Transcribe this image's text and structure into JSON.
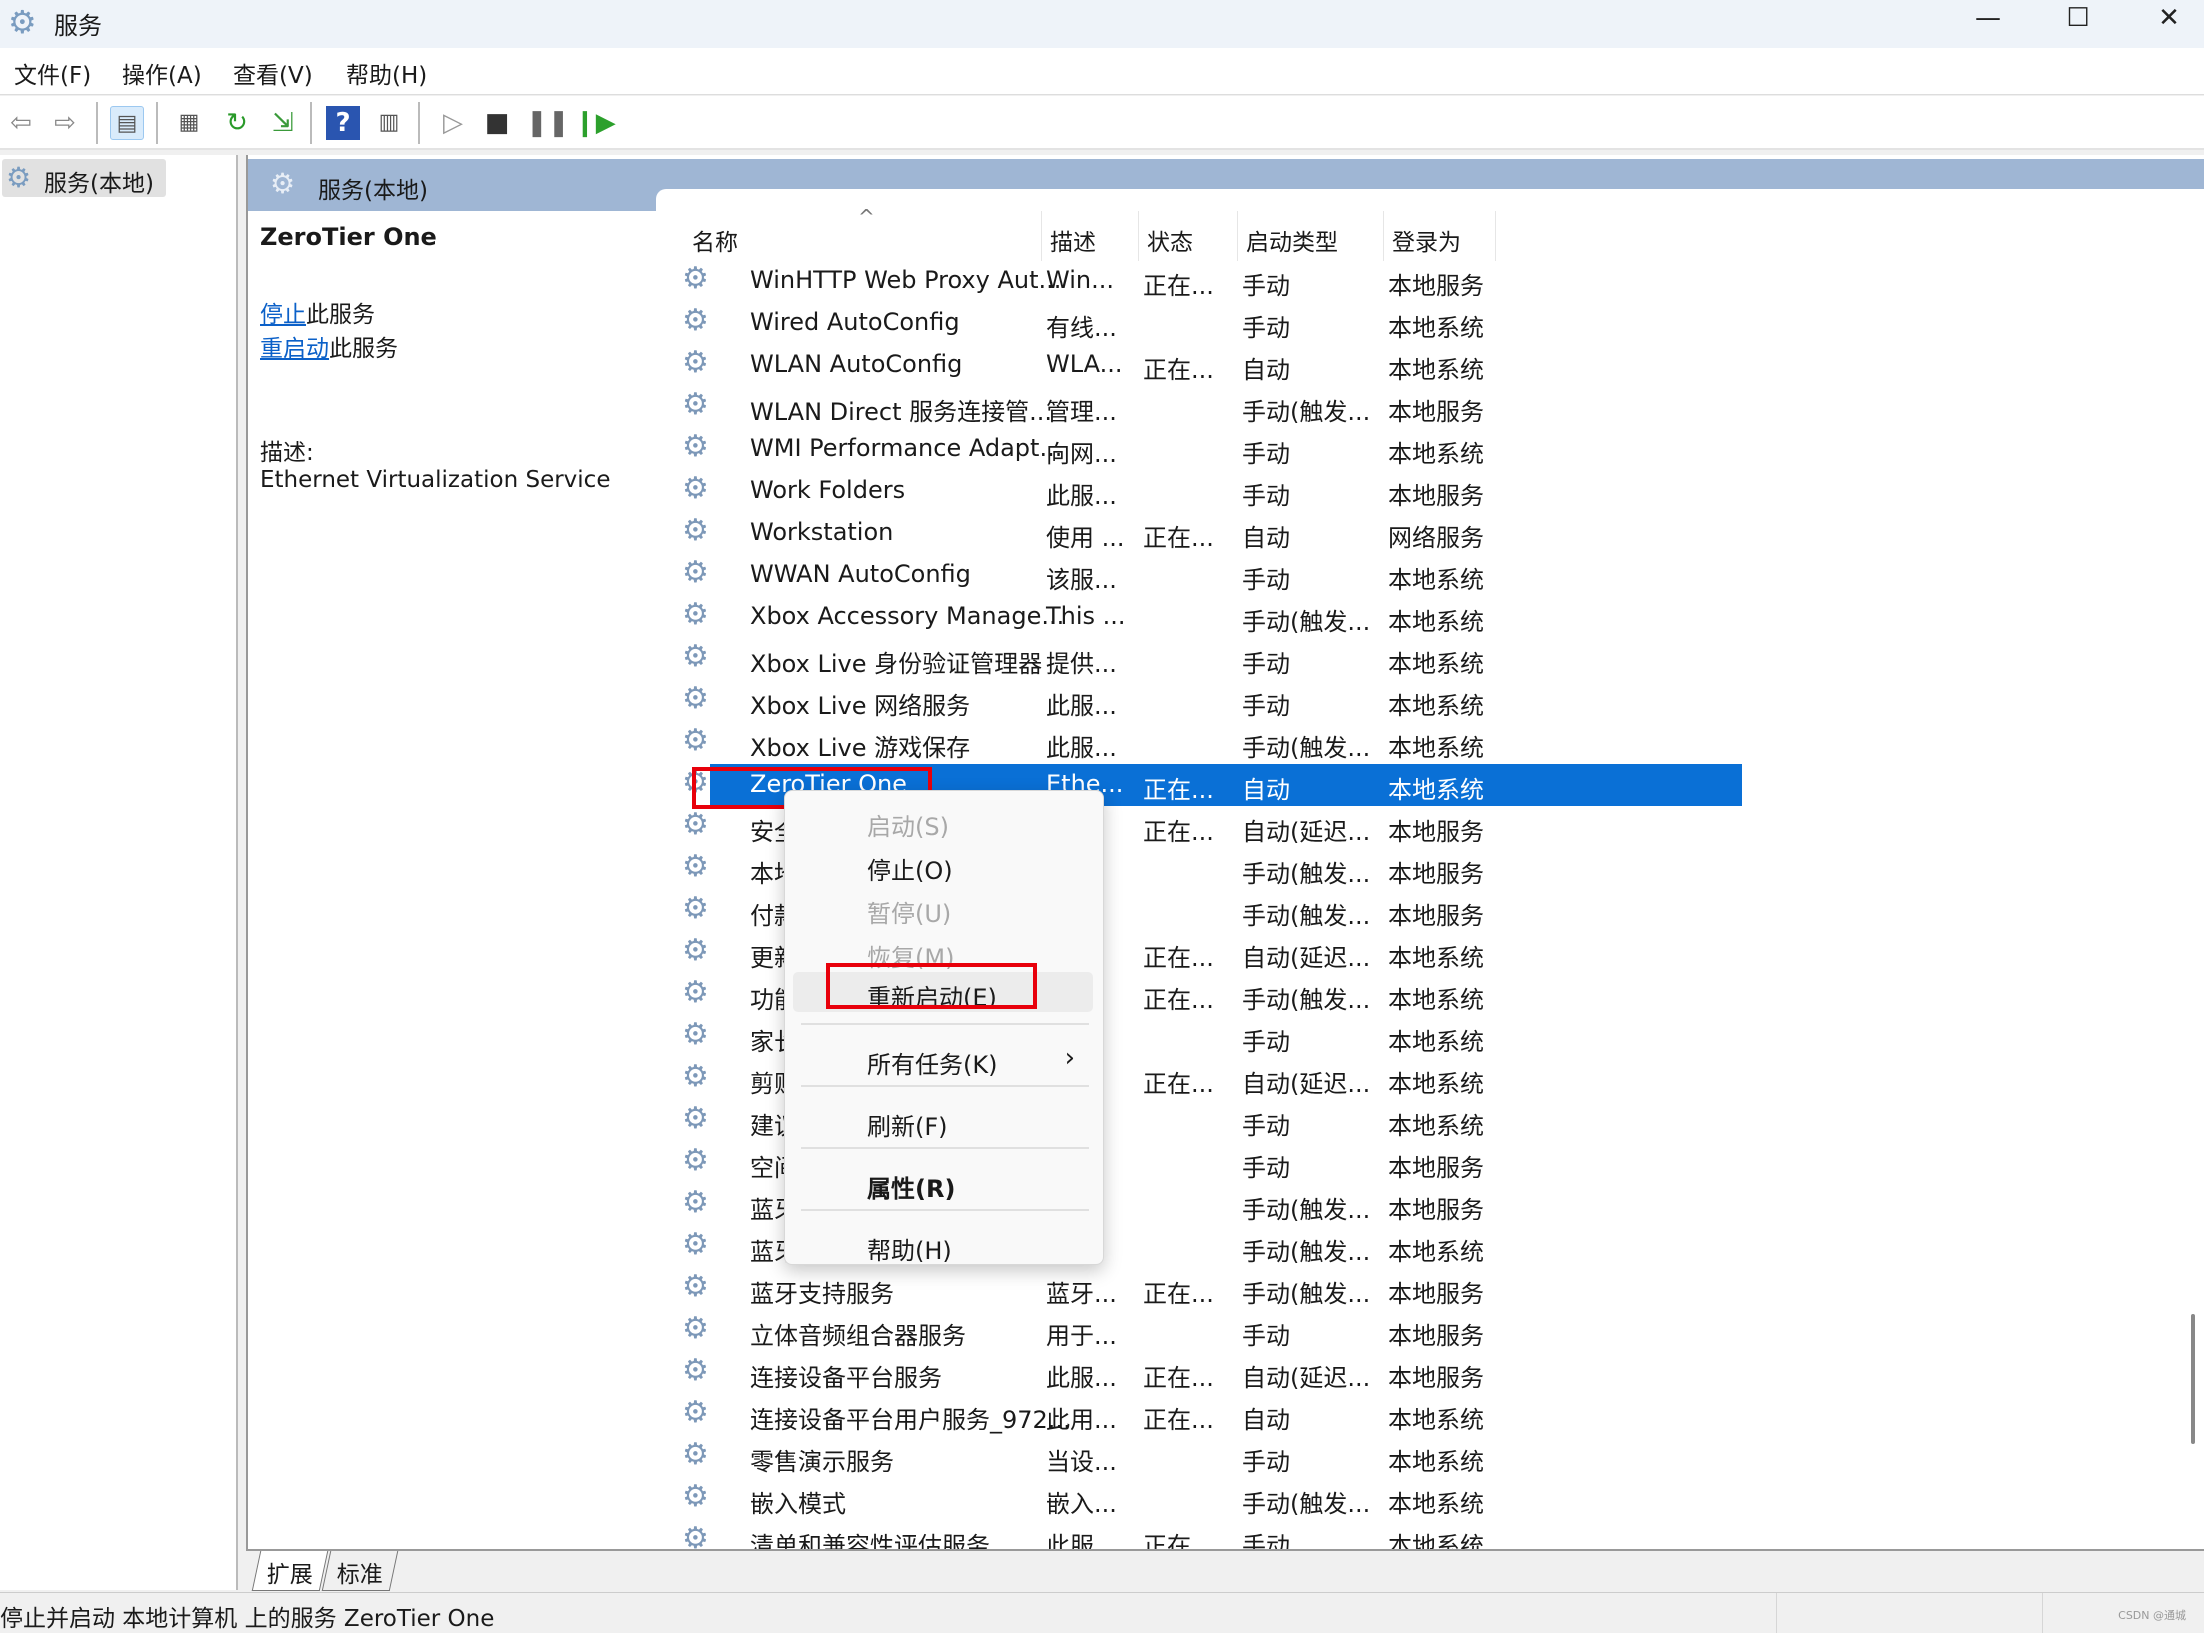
{
  "window": {
    "title": "服务",
    "minimize": "—",
    "maximize": "☐",
    "close": "✕"
  },
  "menubar": [
    "文件(F)",
    "操作(A)",
    "查看(V)",
    "帮助(H)"
  ],
  "toolbar": {
    "icons": [
      "back-arrow-icon",
      "forward-arrow-icon",
      "show-hide-console-tree-icon",
      "properties-icon",
      "refresh-icon",
      "export-list-icon",
      "help-icon",
      "action-pane-icon",
      "start-service-icon",
      "stop-service-icon",
      "pause-service-icon",
      "resume-service-icon"
    ]
  },
  "tree": {
    "item": "服务(本地)"
  },
  "panel": {
    "header": "服务(本地)"
  },
  "detail": {
    "title": "ZeroTier One",
    "stop_link": "停止",
    "stop_suffix": "此服务",
    "restart_link": "重启动",
    "restart_suffix": "此服务",
    "desc_label": "描述:",
    "desc": "Ethernet Virtualization Service"
  },
  "columns": {
    "name": "名称",
    "desc": "描述",
    "status": "状态",
    "startup": "启动类型",
    "logon": "登录为",
    "sort_indicator": "^"
  },
  "rows": [
    {
      "name": "WinHTTP Web Proxy Aut...",
      "desc": "Win...",
      "status": "正在...",
      "startup": "手动",
      "logon": "本地服务"
    },
    {
      "name": "Wired AutoConfig",
      "desc": "有线...",
      "status": "",
      "startup": "手动",
      "logon": "本地系统"
    },
    {
      "name": "WLAN AutoConfig",
      "desc": "WLA...",
      "status": "正在...",
      "startup": "自动",
      "logon": "本地系统"
    },
    {
      "name": "WLAN Direct 服务连接管...",
      "desc": "管理...",
      "status": "",
      "startup": "手动(触发...",
      "logon": "本地服务"
    },
    {
      "name": "WMI Performance Adapt...",
      "desc": "向网...",
      "status": "",
      "startup": "手动",
      "logon": "本地系统"
    },
    {
      "name": "Work Folders",
      "desc": "此服...",
      "status": "",
      "startup": "手动",
      "logon": "本地服务"
    },
    {
      "name": "Workstation",
      "desc": "使用 ...",
      "status": "正在...",
      "startup": "自动",
      "logon": "网络服务"
    },
    {
      "name": "WWAN AutoConfig",
      "desc": "该服...",
      "status": "",
      "startup": "手动",
      "logon": "本地系统"
    },
    {
      "name": "Xbox Accessory Manage...",
      "desc": "This ...",
      "status": "",
      "startup": "手动(触发...",
      "logon": "本地系统"
    },
    {
      "name": "Xbox Live 身份验证管理器",
      "desc": "提供...",
      "status": "",
      "startup": "手动",
      "logon": "本地系统"
    },
    {
      "name": "Xbox Live 网络服务",
      "desc": "此服...",
      "status": "",
      "startup": "手动",
      "logon": "本地系统"
    },
    {
      "name": "Xbox Live 游戏保存",
      "desc": "此服...",
      "status": "",
      "startup": "手动(触发...",
      "logon": "本地系统"
    },
    {
      "name": "ZeroTier One",
      "desc": "Ethe...",
      "status": "正在...",
      "startup": "自动",
      "logon": "本地系统",
      "selected": true
    },
    {
      "name": "安全中",
      "desc": "",
      "status": "正在...",
      "startup": "自动(延迟...",
      "logon": "本地服务"
    },
    {
      "name": "本地配",
      "desc": "",
      "status": "",
      "startup": "手动(触发...",
      "logon": "本地服务"
    },
    {
      "name": "付款和",
      "desc": "",
      "status": "",
      "startup": "手动(触发...",
      "logon": "本地服务"
    },
    {
      "name": "更新 C",
      "desc": "",
      "status": "正在...",
      "startup": "自动(延迟...",
      "logon": "本地系统"
    },
    {
      "name": "功能访",
      "desc": "",
      "status": "正在...",
      "startup": "手动(触发...",
      "logon": "本地系统"
    },
    {
      "name": "家长控",
      "desc": "",
      "status": "",
      "startup": "手动",
      "logon": "本地系统"
    },
    {
      "name": "剪贴板",
      "desc": "",
      "status": "正在...",
      "startup": "自动(延迟...",
      "logon": "本地系统"
    },
    {
      "name": "建议疑",
      "desc": "",
      "status": "",
      "startup": "手动",
      "logon": "本地系统"
    },
    {
      "name": "空间数",
      "desc": "",
      "status": "",
      "startup": "手动",
      "logon": "本地服务"
    },
    {
      "name": "蓝牙音",
      "desc": "",
      "status": "",
      "startup": "手动(触发...",
      "logon": "本地服务"
    },
    {
      "name": "蓝牙用",
      "desc": "",
      "status": "",
      "startup": "手动(触发...",
      "logon": "本地系统"
    },
    {
      "name": "蓝牙支持服务",
      "desc": "蓝牙...",
      "status": "正在...",
      "startup": "手动(触发...",
      "logon": "本地服务"
    },
    {
      "name": "立体音频组合器服务",
      "desc": "用于...",
      "status": "",
      "startup": "手动",
      "logon": "本地服务"
    },
    {
      "name": "连接设备平台服务",
      "desc": "此服...",
      "status": "正在...",
      "startup": "自动(延迟...",
      "logon": "本地服务"
    },
    {
      "name": "连接设备平台用户服务_972...",
      "desc": "此用...",
      "status": "正在...",
      "startup": "自动",
      "logon": "本地系统"
    },
    {
      "name": "零售演示服务",
      "desc": "当设...",
      "status": "",
      "startup": "手动",
      "logon": "本地系统"
    },
    {
      "name": "嵌入模式",
      "desc": "嵌入...",
      "status": "",
      "startup": "手动(触发...",
      "logon": "本地系统"
    },
    {
      "name": "清单和兼容性评估服务",
      "desc": "此服...",
      "status": "正在...",
      "startup": "手动",
      "logon": "本地系统"
    }
  ],
  "context_menu": [
    {
      "label": "启动(S)",
      "disabled": true
    },
    {
      "label": "停止(O)"
    },
    {
      "label": "暂停(U)",
      "disabled": true
    },
    {
      "label": "恢复(M)",
      "disabled": true
    },
    {
      "label": "重新启动(E)",
      "hover": true
    },
    {
      "label": "所有任务(K)",
      "submenu": "›"
    },
    {
      "label": "刷新(F)"
    },
    {
      "label": "属性(R)",
      "bold": true
    },
    {
      "label": "帮助(H)"
    }
  ],
  "highlight_color": "#e8000b",
  "selection_color": "#0a70d6",
  "tabs": [
    "扩展",
    "标准"
  ],
  "status": {
    "text": "停止并启动 本地计算机 上的服务 ZeroTier One",
    "watermark": "CSDN @通城"
  }
}
